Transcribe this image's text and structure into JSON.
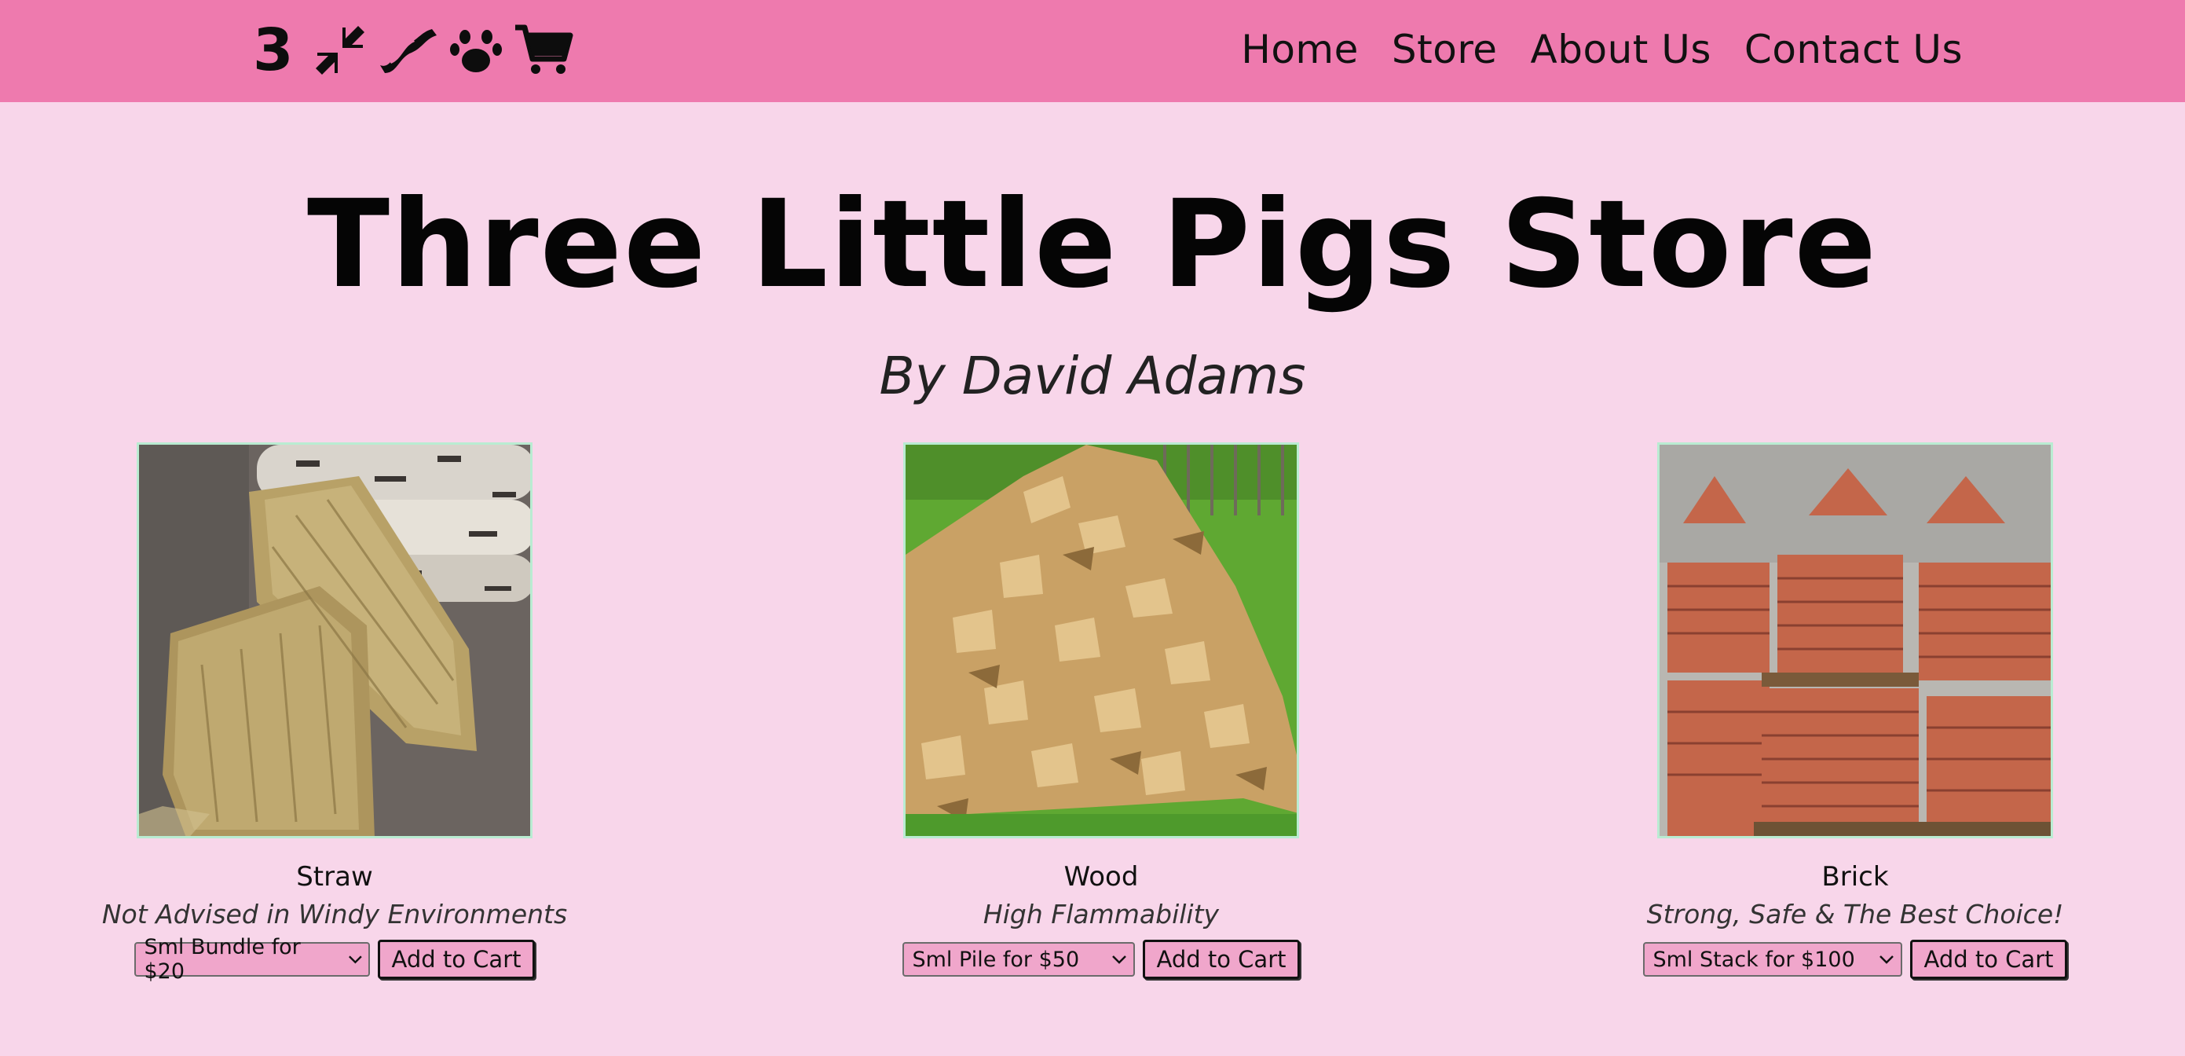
{
  "header": {
    "logo_text": "3",
    "icons": [
      "arrows-in-icon",
      "bacon-icon",
      "paw-icon",
      "shopping-cart-icon"
    ],
    "nav": [
      "Home",
      "Store",
      "About Us",
      "Contact Us"
    ]
  },
  "hero": {
    "title": "Three Little Pigs Store",
    "subtitle": "By David Adams"
  },
  "products": [
    {
      "name": "Straw",
      "desc": "Not Advised in Windy Environments",
      "option": "Sml Bundle for $20",
      "button": "Add to Cart"
    },
    {
      "name": "Wood",
      "desc": "High Flammability",
      "option": "Sml Pile for $50",
      "button": "Add to Cart"
    },
    {
      "name": "Brick",
      "desc": "Strong, Safe & The Best Choice!",
      "option": "Sml Stack for $100",
      "button": "Add to Cart"
    }
  ],
  "colors": {
    "header_bg": "#ee7aae",
    "page_bg": "#f8d6ea",
    "control_bg": "#f0a6cb",
    "image_border": "#b9ecd2"
  }
}
